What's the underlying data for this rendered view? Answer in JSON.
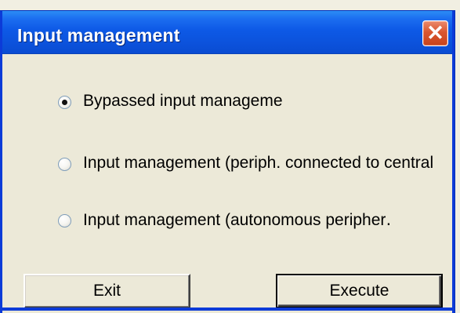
{
  "window": {
    "title": "Input management",
    "close_label": "✕"
  },
  "options": {
    "items": [
      {
        "label": "Bypassed input manageme",
        "selected": true
      },
      {
        "label": "Input management (periph. connected to central",
        "selected": false
      },
      {
        "label": "Input management (autonomous peripher․",
        "selected": false
      }
    ]
  },
  "buttons": {
    "exit_label": "Exit",
    "execute_label": "Execute"
  },
  "colors": {
    "title_bar": "#0d59e6",
    "window_background": "#ece9d8",
    "close_button": "#d9562f"
  },
  "icons": {
    "close": "close-icon"
  }
}
